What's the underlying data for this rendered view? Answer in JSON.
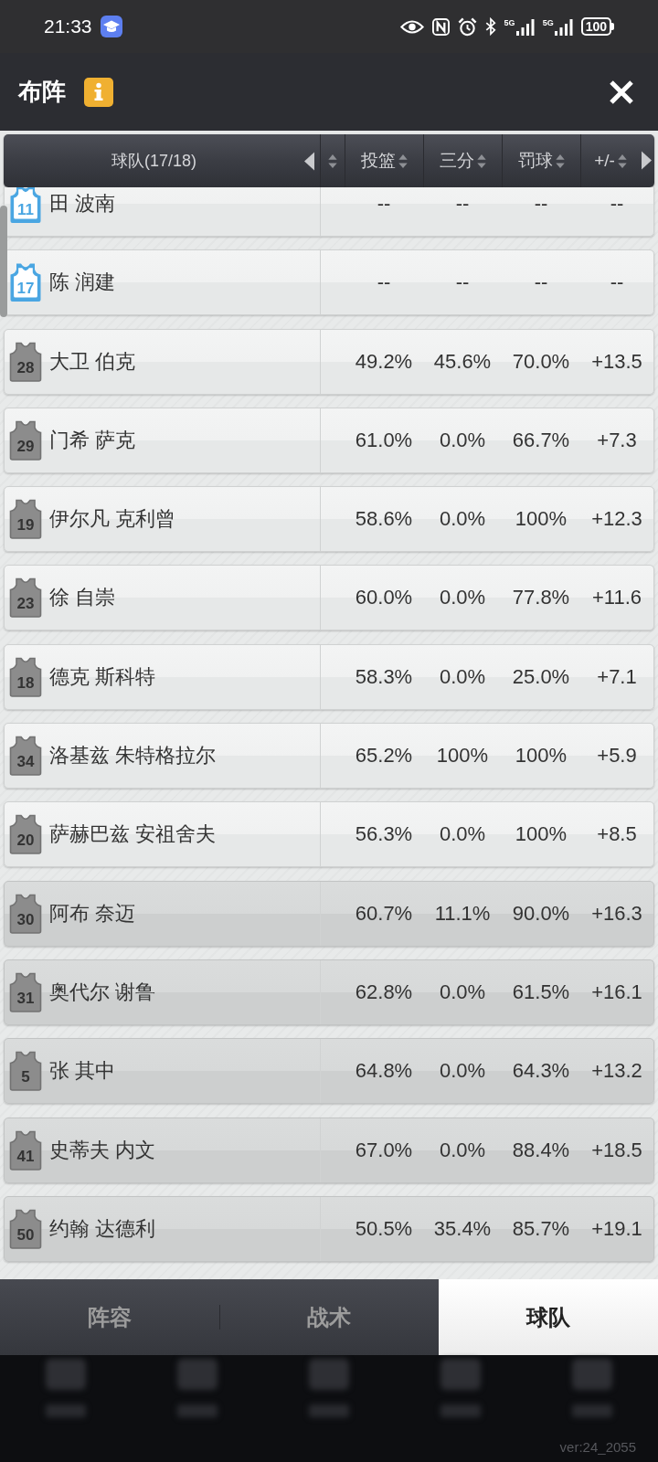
{
  "status_bar": {
    "time": "21:33",
    "signals": [
      "5G",
      "5G"
    ],
    "battery": "100"
  },
  "header": {
    "title": "布阵"
  },
  "table": {
    "columns": [
      {
        "label": "球队(17/18)"
      },
      {
        "label": "投篮"
      },
      {
        "label": "三分"
      },
      {
        "label": "罚球"
      },
      {
        "label": "+/-"
      }
    ],
    "rows": [
      {
        "number": "11",
        "name": "田 波南",
        "kind": "outline",
        "color": "#4aa6e2",
        "shaded": false,
        "values": [
          "--",
          "--",
          "--",
          "--"
        ]
      },
      {
        "number": "17",
        "name": "陈 润建",
        "kind": "outline",
        "color": "#4aa6e2",
        "shaded": false,
        "values": [
          "--",
          "--",
          "--",
          "--"
        ]
      },
      {
        "number": "28",
        "name": "大卫 伯克",
        "kind": "filled",
        "color": "#8c8c8c",
        "shaded": false,
        "values": [
          "49.2%",
          "45.6%",
          "70.0%",
          "+13.5"
        ]
      },
      {
        "number": "29",
        "name": "门希 萨克",
        "kind": "filled",
        "color": "#8c8c8c",
        "shaded": false,
        "values": [
          "61.0%",
          "0.0%",
          "66.7%",
          "+7.3"
        ]
      },
      {
        "number": "19",
        "name": "伊尔凡 克利曾",
        "kind": "filled",
        "color": "#8c8c8c",
        "shaded": false,
        "values": [
          "58.6%",
          "0.0%",
          "100%",
          "+12.3"
        ]
      },
      {
        "number": "23",
        "name": "徐 自崇",
        "kind": "filled",
        "color": "#8c8c8c",
        "shaded": false,
        "values": [
          "60.0%",
          "0.0%",
          "77.8%",
          "+11.6"
        ]
      },
      {
        "number": "18",
        "name": "德克 斯科特",
        "kind": "filled",
        "color": "#8c8c8c",
        "shaded": false,
        "values": [
          "58.3%",
          "0.0%",
          "25.0%",
          "+7.1"
        ]
      },
      {
        "number": "34",
        "name": "洛基兹 朱特格拉尔",
        "kind": "filled",
        "color": "#8c8c8c",
        "shaded": false,
        "values": [
          "65.2%",
          "100%",
          "100%",
          "+5.9"
        ]
      },
      {
        "number": "20",
        "name": "萨赫巴兹 安祖舍夫",
        "kind": "filled",
        "color": "#8c8c8c",
        "shaded": false,
        "values": [
          "56.3%",
          "0.0%",
          "100%",
          "+8.5"
        ]
      },
      {
        "number": "30",
        "name": "阿布 奈迈",
        "kind": "filled",
        "color": "#8c8c8c",
        "shaded": true,
        "values": [
          "60.7%",
          "11.1%",
          "90.0%",
          "+16.3"
        ]
      },
      {
        "number": "31",
        "name": "奥代尔 谢鲁",
        "kind": "filled",
        "color": "#8c8c8c",
        "shaded": true,
        "values": [
          "62.8%",
          "0.0%",
          "61.5%",
          "+16.1"
        ]
      },
      {
        "number": "5",
        "name": "张 其中",
        "kind": "filled",
        "color": "#8c8c8c",
        "shaded": true,
        "values": [
          "64.8%",
          "0.0%",
          "64.3%",
          "+13.2"
        ]
      },
      {
        "number": "41",
        "name": "史蒂夫 内文",
        "kind": "filled",
        "color": "#8c8c8c",
        "shaded": true,
        "values": [
          "67.0%",
          "0.0%",
          "88.4%",
          "+18.5"
        ]
      },
      {
        "number": "50",
        "name": "约翰 达德利",
        "kind": "filled",
        "color": "#8c8c8c",
        "shaded": true,
        "values": [
          "50.5%",
          "35.4%",
          "85.7%",
          "+19.1"
        ]
      }
    ]
  },
  "tabs": [
    {
      "label": "阵容",
      "selected": false
    },
    {
      "label": "战术",
      "selected": false
    },
    {
      "label": "球队",
      "selected": true
    }
  ],
  "version": "ver:24_2055"
}
